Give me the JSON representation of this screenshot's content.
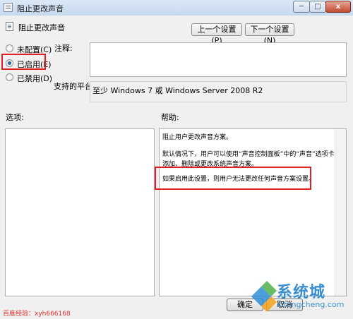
{
  "window": {
    "title": "阻止更改声音",
    "min_label": "─",
    "max_label": "□",
    "close_label": "x"
  },
  "setting": {
    "name": "阻止更改声音"
  },
  "nav": {
    "prev_label": "上一个设置(P)",
    "next_label": "下一个设置(N)"
  },
  "state": {
    "options": [
      {
        "label": "未配置(C)",
        "selected": false
      },
      {
        "label": "已启用(E)",
        "selected": true
      },
      {
        "label": "已禁用(D)",
        "selected": false
      }
    ]
  },
  "comment": {
    "label": "注释:",
    "value": ""
  },
  "platform": {
    "label": "支持的平台:",
    "value": "至少 Windows 7 或 Windows Server 2008 R2"
  },
  "panes": {
    "options_label": "选项:",
    "help_label": "帮助:"
  },
  "help": {
    "line1": "阻止用户更改声音方案。",
    "line2": "默认情况下，用户可以使用“声音控制面板”中的“声音”选项卡",
    "line3": "添加、删除或更改系统声音方案。",
    "line4": "如果启用此设置，则用户无法更改任何声音方案设置。"
  },
  "buttons": {
    "ok_label": "确定",
    "cancel_label": "取消"
  },
  "watermark": {
    "left_text": "百度经验：xyh666168",
    "site_name": "系统城",
    "site_url": "xitongcheng.com"
  },
  "colors": {
    "highlight": "#e02020",
    "title_bar": "#c6d9ef",
    "watermark_blue": "#3a8fd0"
  }
}
